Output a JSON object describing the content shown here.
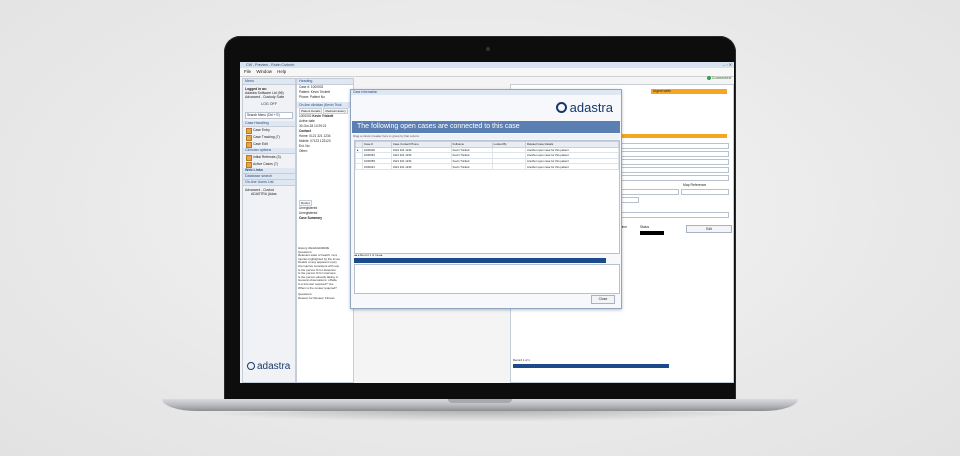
{
  "window": {
    "title": "CW - Preview - Robin Cuthorb",
    "connected": "Connected"
  },
  "menu": {
    "file": "File",
    "window": "Window",
    "help": "Help"
  },
  "left": {
    "header": "Menu",
    "logged_in_title": "Logged in as:",
    "logged_in_line1": "Adastra Software Ltd (96)",
    "logged_in_line2": "Advanced - Custody Suite",
    "logoff": "LOG OFF",
    "search_placeholder": "Search Menu (Ctrl + E)",
    "case_handling": "Case Handling",
    "items": [
      {
        "label": "Case Entry"
      },
      {
        "label": "Case Tracking (7)"
      },
      {
        "label": "Case Edit"
      }
    ],
    "clinician_options": "Clinician options",
    "clin_items": [
      {
        "label": "Initial Referrals (3)"
      },
      {
        "label": "Active Cases (7)"
      }
    ],
    "quick_links": "Web Links",
    "database_search": "Database search",
    "on_line_users": "On-line Users List",
    "user_line1": "Advanced - Custod",
    "user_line2": "ADASTRA (Adas",
    "logo_text": "adastra"
  },
  "mid": {
    "header": "Heading",
    "case_no_label": "Case #:",
    "case_no": "1000002",
    "patient_label": "Patient:",
    "patient": "Kevin Trickett",
    "phone_label": "Phone:",
    "phone": "Patient No",
    "on_line": "On-line clinician (Kevin Trick",
    "tabs": [
      "Patient Details",
      "Medical History"
    ],
    "case_ref": "1000002",
    "patient_name": "Kevin Trickett",
    "active_date_label": "Active date",
    "active_date": "30-Oct-18 10:29:21",
    "contact": "Contact",
    "home_label": "Home:",
    "home": "0121 321 1234",
    "mobile_label": "Mobile:",
    "mobile": "0121 321 1234",
    "ext_label": "Ext. No:",
    "other_label": "Other:",
    "mobile_no": "07123 123123",
    "doctor_tab": "Doctor",
    "unreg1": "Unregistered",
    "unreg2": "Unregistered",
    "case_summary": "Case Summary",
    "summary_lines": [
      "History:dfsdsfdsfdfdfdfk",
      "Questions:",
      "Relevant state of health: xxxx",
      "Injuries highlighted by the inves",
      "Details of any apparent injury",
      "Are injuries consistent with exp",
      "Is the person fit for detention",
      "Is the person fit for interview",
      "Is the person already taking m",
      "General observations: offside",
      "Is a forensic required? Yes",
      "When is the review required?",
      "Questions:",
      "Reason for Review: Fitness"
    ]
  },
  "right": {
    "orange_label": "Urgent week",
    "map_reference": "Map Reference",
    "time_label": "Time",
    "status_label": "Status",
    "edit_label": "Edit",
    "pager": "Record 1 of 1"
  },
  "dialog": {
    "title": "Case Information",
    "logo_text": "adastra",
    "heading": "The following open cases are connected to this case",
    "group_hint": "Drag a column header here to group by that column",
    "columns": [
      "Case #",
      "Case Contact Phone",
      "Fullname",
      "Locked By",
      "Related Case Details"
    ],
    "rows": [
      {
        "case": "1000026",
        "phone": "0121 321 1234",
        "name": "Kevin Trickett",
        "locked": "",
        "details": "Another open case for this patient"
      },
      {
        "case": "1000054",
        "phone": "0121 321 1234",
        "name": "Kevin Trickett",
        "locked": "",
        "details": "Another open case for this patient"
      },
      {
        "case": "1000059",
        "phone": "0121 321 1234",
        "name": "Kevin Trickett",
        "locked": "",
        "details": "Another open case for this patient"
      },
      {
        "case": "1000031",
        "phone": "0121 321 1234",
        "name": "Kevin Trickett",
        "locked": "",
        "details": "Another open case for this patient"
      }
    ],
    "pager": "Record 1 of 4",
    "close": "Close"
  },
  "colors": {
    "brand": "#163a6b",
    "heading_bar": "#5b7fb3",
    "accent_orange": "#f5a623",
    "pager_bar": "#1c4a8a"
  }
}
